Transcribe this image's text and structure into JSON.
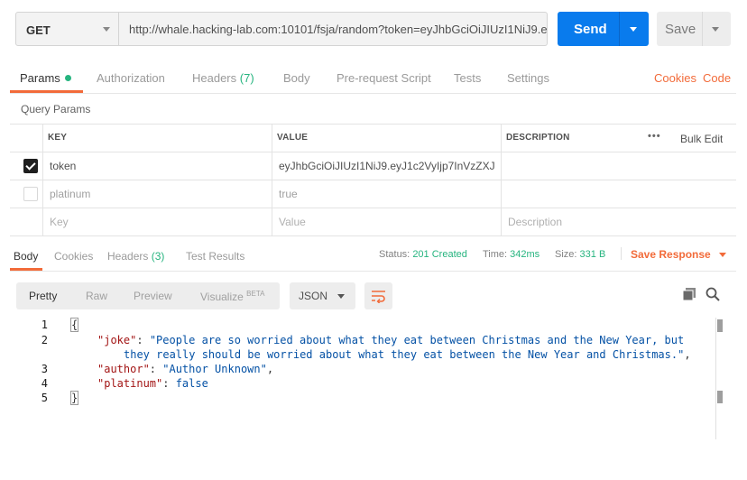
{
  "request": {
    "method": "GET",
    "url": "http://whale.hacking-lab.com:10101/fsja/random?token=eyJhbGciOiJIUzI1NiJ9.e...",
    "send_label": "Send",
    "save_label": "Save"
  },
  "request_tabs": {
    "params": "Params",
    "authorization": "Authorization",
    "headers": "Headers",
    "headers_count": "(7)",
    "body": "Body",
    "prerequest": "Pre-request Script",
    "tests": "Tests",
    "settings": "Settings",
    "cookies": "Cookies",
    "code": "Code"
  },
  "query_params": {
    "title": "Query Params",
    "headers": {
      "key": "KEY",
      "value": "VALUE",
      "description": "DESCRIPTION",
      "more": "•••",
      "bulk_edit": "Bulk Edit"
    },
    "rows": [
      {
        "checked": true,
        "key": "token",
        "value": "eyJhbGciOiJIUzI1NiJ9.eyJ1c2VyIjp7InVzZXJ...",
        "description": ""
      },
      {
        "checked": false,
        "key": "platinum",
        "value": "true",
        "description": ""
      }
    ],
    "placeholder": {
      "key": "Key",
      "value": "Value",
      "description": "Description"
    }
  },
  "response_tabs": {
    "body": "Body",
    "cookies": "Cookies",
    "headers": "Headers",
    "headers_count": "(3)",
    "test_results": "Test Results"
  },
  "status": {
    "status_label": "Status:",
    "status_value": "201 Created",
    "time_label": "Time:",
    "time_value": "342ms",
    "size_label": "Size:",
    "size_value": "331 B",
    "save_response": "Save Response"
  },
  "format": {
    "pretty": "Pretty",
    "raw": "Raw",
    "preview": "Preview",
    "visualize": "Visualize",
    "beta": "BETA",
    "language": "JSON"
  },
  "code": {
    "line_numbers": [
      "1",
      "2",
      "3",
      "4",
      "5"
    ],
    "l1": "{",
    "joke_key": "\"joke\"",
    "joke_val_1": "\"People are so worried about what they eat between Christmas and the New Year, but",
    "joke_val_2": "they really should be worried about what they eat between the New Year and Christmas.\"",
    "author_key": "\"author\"",
    "author_val": "\"Author Unknown\"",
    "platinum_key": "\"platinum\"",
    "platinum_val": "false",
    "l5": "}"
  },
  "icons": [
    "chevron-down-icon",
    "wrap-lines-icon",
    "copy-icon",
    "search-icon"
  ],
  "colors": {
    "accent": "#f26b3a",
    "send": "#097bed",
    "success": "#26b47f"
  }
}
